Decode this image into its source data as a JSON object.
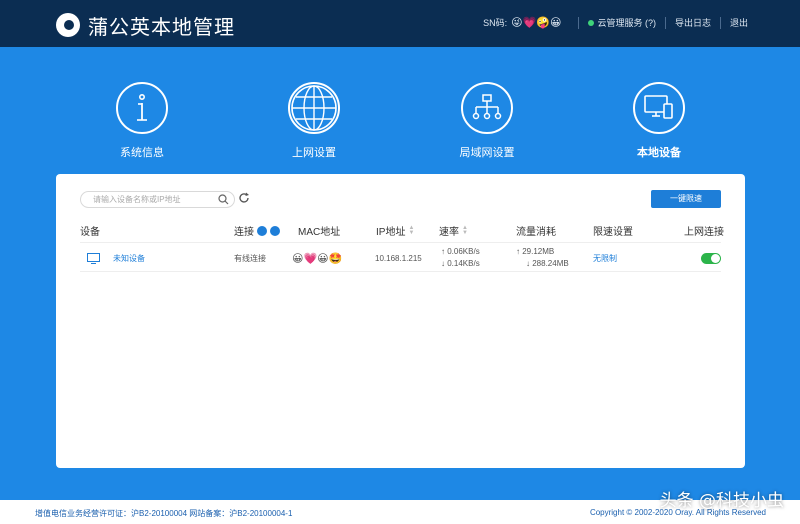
{
  "header": {
    "app_title": "蒲公英本地管理",
    "sn_label": "SN码:",
    "sn_value": "😜💗🤪😀",
    "cloud_service": "云管理服务 (?)",
    "export_log": "导出日志",
    "logout": "退出",
    "cloud_status_color": "#3fd47a"
  },
  "nav": [
    {
      "label": "系统信息",
      "icon": "info-icon"
    },
    {
      "label": "上网设置",
      "icon": "globe-icon"
    },
    {
      "label": "局域网设置",
      "icon": "network-tree-icon"
    },
    {
      "label": "本地设备",
      "icon": "devices-icon",
      "active": true
    }
  ],
  "toolbar": {
    "search_placeholder": "请输入设备名称或IP地址",
    "limit_button": "一键限速"
  },
  "table": {
    "headers": {
      "device": "设备",
      "connection": "连接",
      "mac": "MAC地址",
      "ip": "IP地址",
      "speed": "速率",
      "traffic": "流量消耗",
      "limit": "限速设置",
      "internet": "上网连接"
    },
    "rows": [
      {
        "device_name": "未知设备",
        "connection": "有线连接",
        "mac": "😀💗😀🤩",
        "ip": "10.168.1.215",
        "speed_up": "↑ 0.06KB/s",
        "speed_down": "↓ 0.14KB/s",
        "traffic_up": "↑ 29.12MB",
        "traffic_down": "↓ 288.24MB",
        "limit": "无限制",
        "internet_enabled": true
      }
    ]
  },
  "footer": {
    "left": "增值电信业务经营许可证：沪B2-20100004 网站备案：沪B2-20100004-1",
    "right": "Copyright © 2002-2020 Oray. All Rights Reserved"
  },
  "watermark": "头条 @科技小虫",
  "colors": {
    "brand_blue": "#1e88e5",
    "header_navy": "#0b2d52",
    "accent": "#1e7ed8",
    "toggle_on": "#2cb44a"
  }
}
